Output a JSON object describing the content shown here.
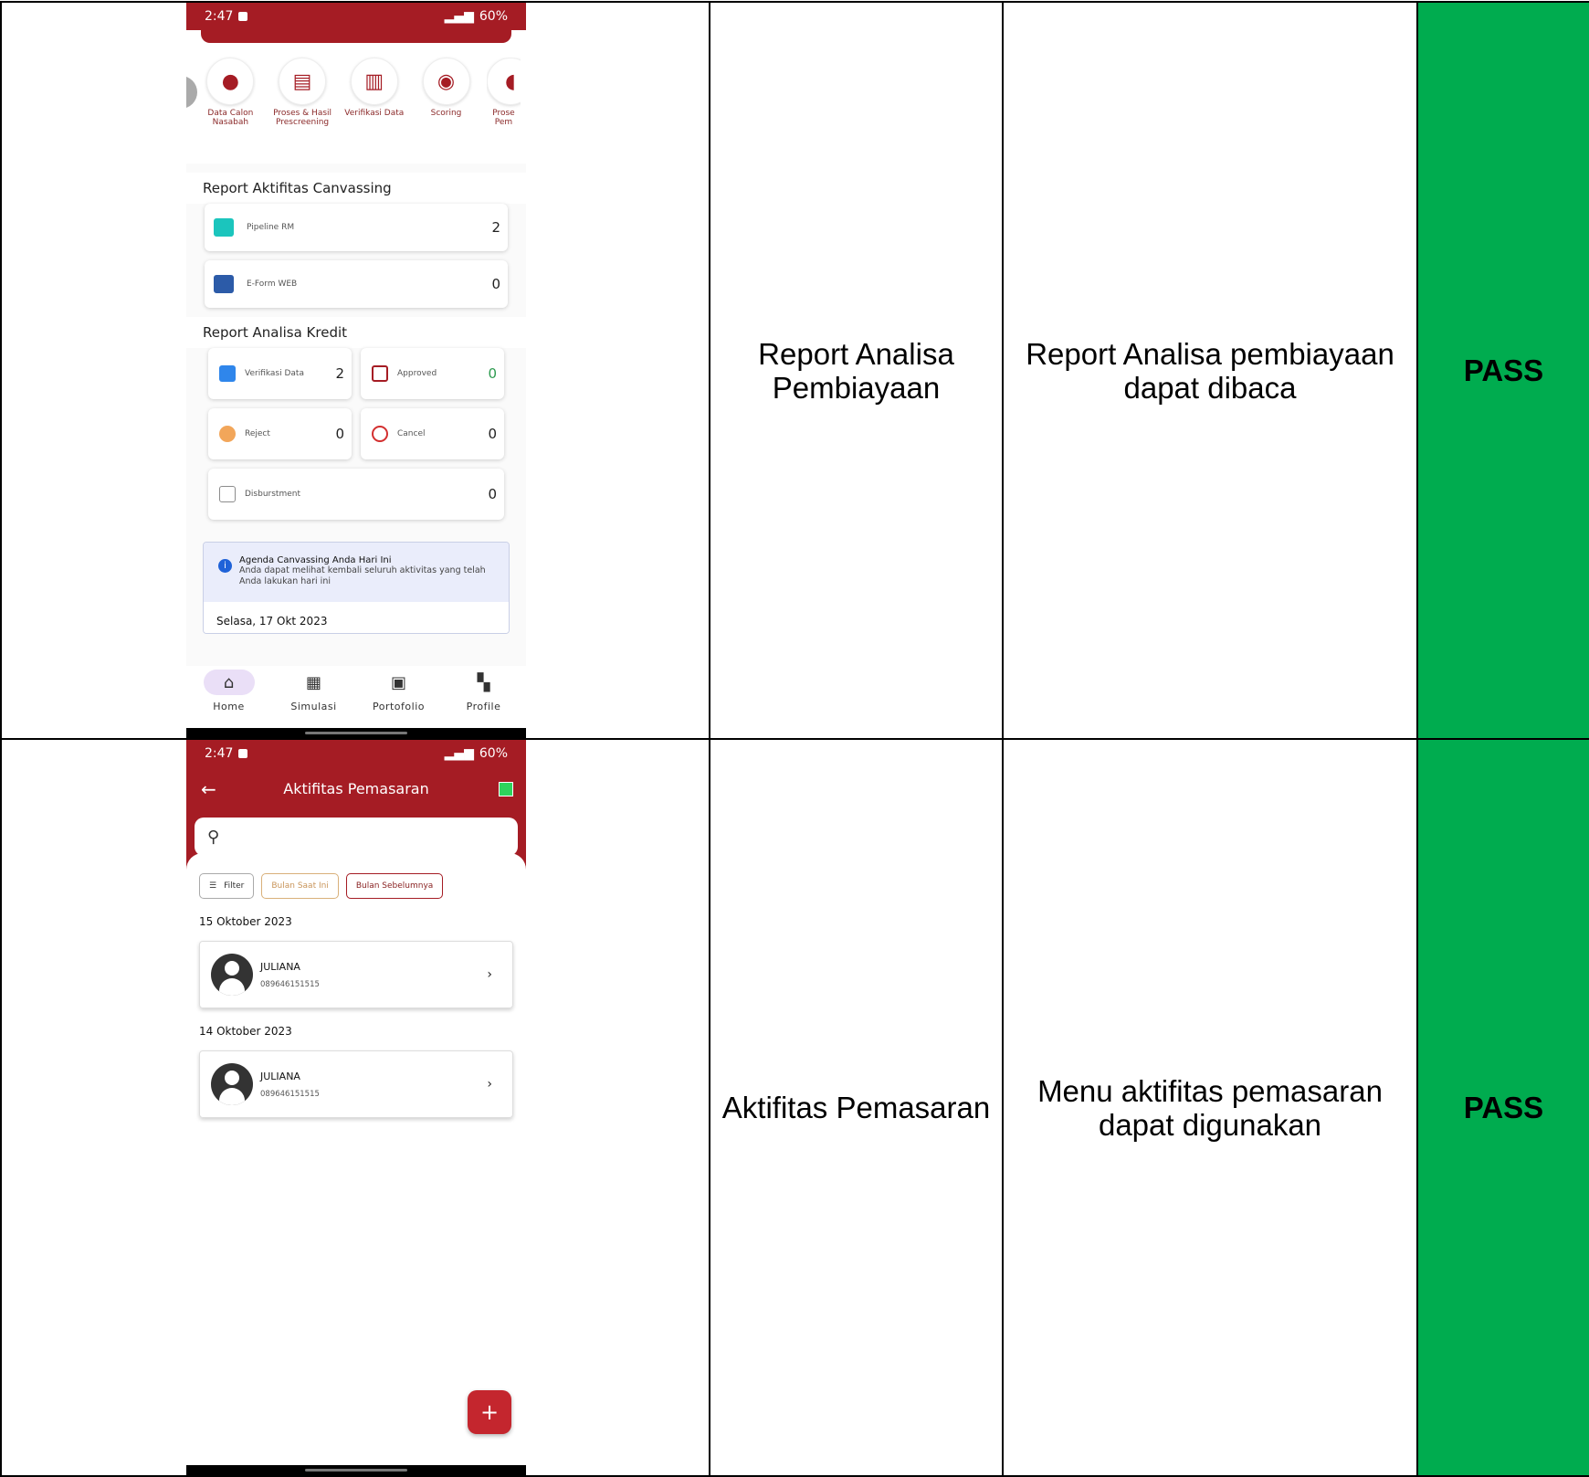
{
  "rows": [
    {
      "feature": "Report Analisa Pembiayaan",
      "expected": "Report Analisa pembiayaan dapat dibaca",
      "result": "PASS",
      "screen": {
        "status": {
          "time": "2:47",
          "battery": "60%"
        },
        "menu": [
          {
            "label": "Data Calon Nasabah",
            "icon": "person-icon"
          },
          {
            "label": "Proses & Hasil Prescreening",
            "icon": "document-icon"
          },
          {
            "label": "Verifikasi Data",
            "icon": "file-icon"
          },
          {
            "label": "Scoring",
            "icon": "database-icon"
          },
          {
            "label": "Prose Pem",
            "icon": "partial-icon"
          }
        ],
        "canvassing": {
          "title": "Report Aktifitas Canvassing",
          "items": [
            {
              "label": "Pipeline RM",
              "value": "2",
              "color": "#1bc5bd"
            },
            {
              "label": "E-Form WEB",
              "value": "0",
              "color": "#2c5ba8"
            }
          ]
        },
        "analisa": {
          "title": "Report Analisa Kredit",
          "items": [
            {
              "label": "Verifikasi Data",
              "value": "2",
              "color": "#2f86eb"
            },
            {
              "label": "Approved",
              "value": "0",
              "color": "#2e9b50"
            },
            {
              "label": "Reject",
              "value": "0",
              "color": "#f2a65a"
            },
            {
              "label": "Cancel",
              "value": "0",
              "color": "#d32f2f"
            },
            {
              "label": "Disburstment",
              "value": "0",
              "color": "#8c8c8c"
            }
          ]
        },
        "agenda": {
          "title": "Agenda Canvassing Anda Hari Ini",
          "text": "Anda dapat melihat kembali seluruh aktivitas yang telah Anda lakukan hari ini",
          "date": "Selasa, 17 Okt 2023"
        },
        "nav": [
          {
            "label": "Home",
            "icon": "home-icon"
          },
          {
            "label": "Simulasi",
            "icon": "calculator-icon"
          },
          {
            "label": "Portofolio",
            "icon": "portfolio-icon"
          },
          {
            "label": "Profile",
            "icon": "grid-icon"
          }
        ]
      }
    },
    {
      "feature": "Aktifitas Pemasaran",
      "expected": "Menu aktifitas pemasaran dapat digunakan",
      "result": "PASS",
      "screen": {
        "status": {
          "time": "2:47",
          "battery": "60%"
        },
        "title": "Aktifitas Pemasaran",
        "search_placeholder": "",
        "chips": {
          "filter": "Filter",
          "current": "Bulan Saat Ini",
          "previous": "Bulan Sebelumnya"
        },
        "groups": [
          {
            "date": "15 Oktober 2023",
            "name": "JULIANA",
            "phone": "089646151515"
          },
          {
            "date": "14 Oktober 2023",
            "name": "JULIANA",
            "phone": "089646151515"
          }
        ],
        "fab": "+"
      }
    }
  ],
  "colors": {
    "brand": "#a51c24",
    "pass": "#00ac4f"
  }
}
